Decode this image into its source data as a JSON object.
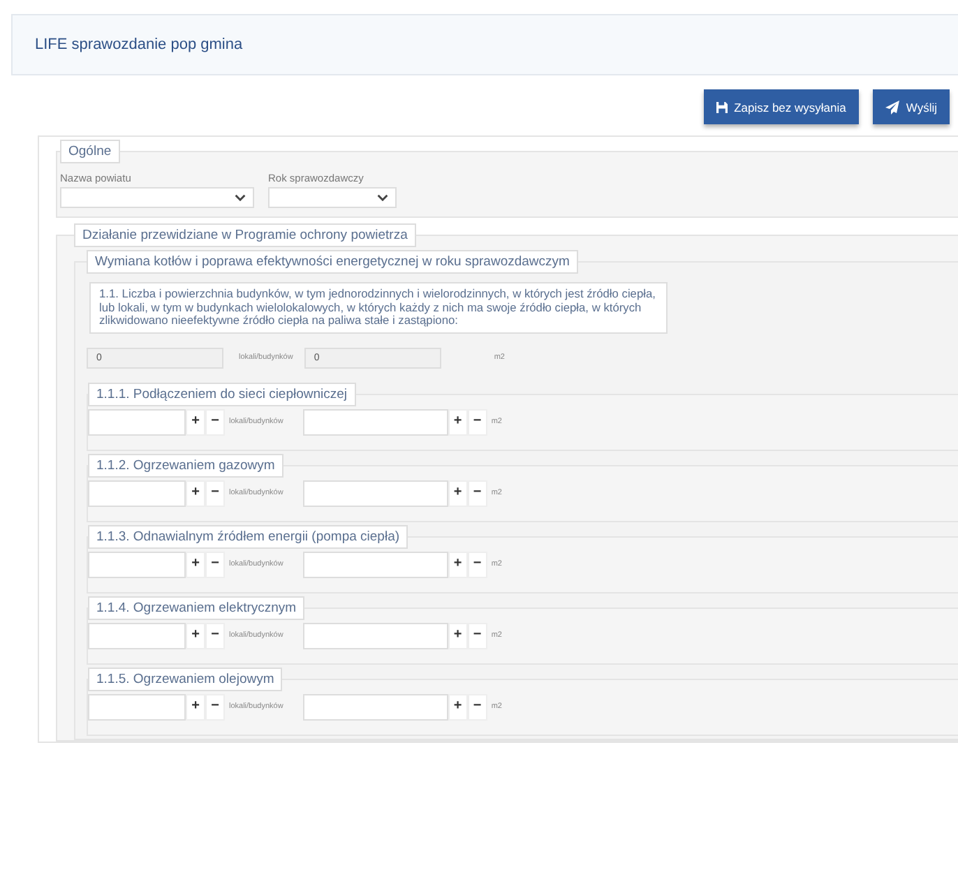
{
  "header": {
    "title": "LIFE sprawozdanie pop gmina"
  },
  "actions": [
    {
      "kind": "save",
      "label": "Zapisz bez wysyłania"
    },
    {
      "kind": "send",
      "label": "Wyślij"
    }
  ],
  "general": {
    "legend": "Ogólne",
    "fields": [
      {
        "label": "Nazwa powiatu"
      },
      {
        "label": "Rok sprawozdawczy"
      }
    ]
  },
  "action_section": {
    "legend": "Działanie przewidziane w Programie ochrony powietrza",
    "group": {
      "legend": "Wymiana kotłów i poprawa efektywności energetycznej w roku sprawozdawczym",
      "question": {
        "text": "1.1. Liczba i powierzchnia budynków, w tym jednorodzinnych i wielorodzinnych, w których jest źródło ciepła, lub lokali, w tym w budynkach wielolokalowych, w których każdy z nich ma swoje źródło ciepła, w których zlikwidowano nieefektywne źródło ciepła na paliwa stałe i zastąpiono:",
        "count_value": "0",
        "count_unit": "lokali/budynków",
        "area_value": "0",
        "area_unit": "m2"
      },
      "items": [
        {
          "legend": "1.1.1. Podłączeniem do sieci ciepłowniczej",
          "fields": [
            {
              "plus": "+",
              "minus": "−",
              "unit": "lokali/budynków"
            },
            {
              "plus": "+",
              "minus": "−",
              "unit": "m2"
            }
          ]
        },
        {
          "legend": "1.1.2. Ogrzewaniem gazowym",
          "fields": [
            {
              "plus": "+",
              "minus": "−",
              "unit": "lokali/budynków"
            },
            {
              "plus": "+",
              "minus": "−",
              "unit": "m2"
            }
          ]
        },
        {
          "legend": "1.1.3. Odnawialnym źródłem energii (pompa ciepła)",
          "fields": [
            {
              "plus": "+",
              "minus": "−",
              "unit": "lokali/budynków"
            },
            {
              "plus": "+",
              "minus": "−",
              "unit": "m2"
            }
          ]
        },
        {
          "legend": "1.1.4. Ogrzewaniem elektrycznym",
          "fields": [
            {
              "plus": "+",
              "minus": "−",
              "unit": "lokali/budynków"
            },
            {
              "plus": "+",
              "minus": "−",
              "unit": "m2"
            }
          ]
        },
        {
          "legend": "1.1.5. Ogrzewaniem olejowym",
          "fields": [
            {
              "plus": "+",
              "minus": "−",
              "unit": "lokali/budynków"
            },
            {
              "plus": "+",
              "minus": "−",
              "unit": "m2"
            }
          ]
        }
      ]
    }
  }
}
